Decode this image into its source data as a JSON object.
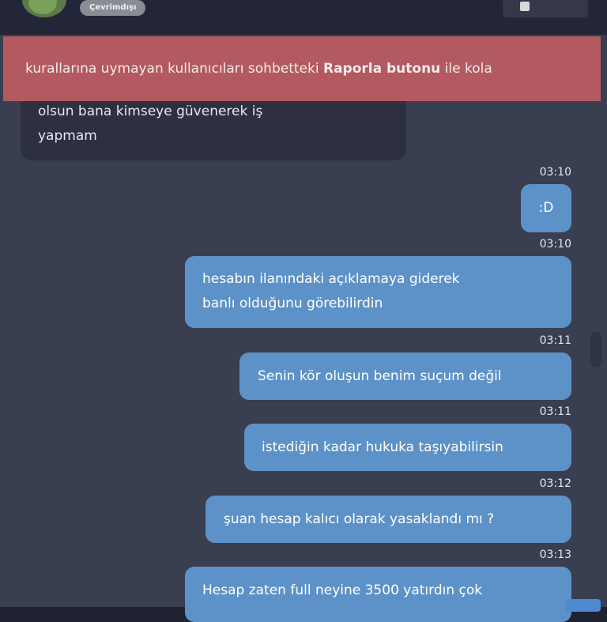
{
  "header": {
    "status_label": "Çevrimdışı"
  },
  "banner": {
    "text_before": "kurallarına uymayan kullanıcıları sohbetteki ",
    "text_bold": "Raporla butonu",
    "text_after": " ile kola"
  },
  "messages": {
    "incoming_lines": [
      "olsun bana kimseye güvenerek iş",
      "yapmam"
    ],
    "m1": {
      "time": "03:10",
      "text": ":D"
    },
    "m2": {
      "time": "03:10",
      "line1": "hesabın ilanındaki açıklamaya giderek",
      "line2": "banlı olduğunu görebilirdin"
    },
    "m3": {
      "time": "03:11",
      "text": "Senin kör oluşun benim suçum değil"
    },
    "m4": {
      "time": "03:11",
      "text": "istediğin kadar hukuka taşıyabilirsin"
    },
    "m5": {
      "time": "03:12",
      "text": "şuan hesap kalıcı olarak yasaklandı mı ?"
    },
    "m6": {
      "time": "03:13",
      "text": "Hesap zaten full neyine 3500 yatırdın çok"
    }
  },
  "colors": {
    "outgoing_bubble": "#5d92c8",
    "incoming_bubble": "#2c3041",
    "banner": "#b25a5f",
    "background": "#393e50"
  }
}
